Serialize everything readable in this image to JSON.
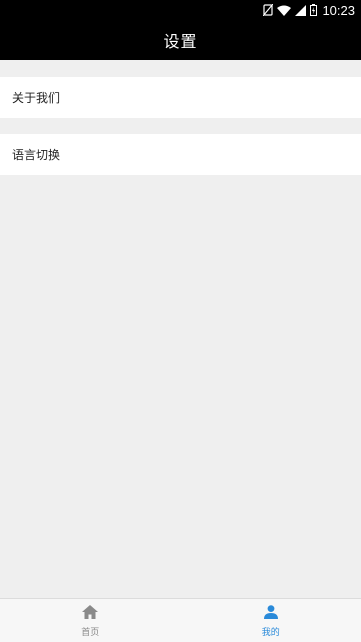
{
  "status_bar": {
    "time": "10:23",
    "icons": [
      "no-sim-icon",
      "wifi-icon",
      "signal-icon",
      "battery-icon"
    ]
  },
  "app_bar": {
    "title": "设置"
  },
  "settings": {
    "items": [
      {
        "label": "关于我们"
      },
      {
        "label": "语言切换"
      }
    ]
  },
  "bottom_nav": {
    "tabs": [
      {
        "label": "首页",
        "icon": "home-icon",
        "active": false
      },
      {
        "label": "我的",
        "icon": "person-icon",
        "active": true
      }
    ]
  },
  "colors": {
    "accent": "#2a8ad9",
    "inactive": "#8a8a8a",
    "background": "#efefef",
    "app_bar": "#000000"
  }
}
